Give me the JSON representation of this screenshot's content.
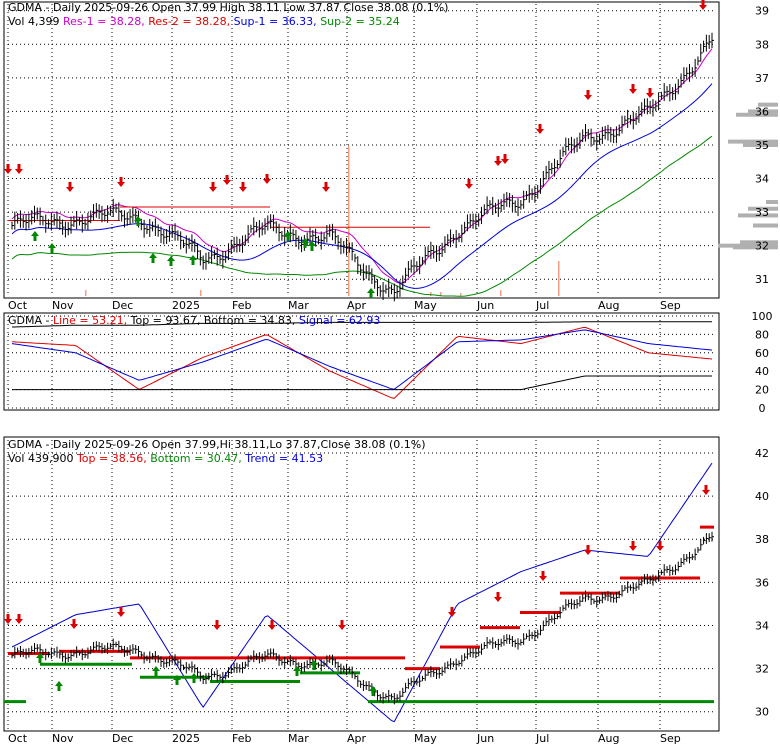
{
  "months": [
    "Oct",
    "Nov",
    "Dec",
    "2025",
    "Feb",
    "Mar",
    "Apr",
    "May",
    "Jun",
    "Jul",
    "Aug",
    "Sep"
  ],
  "colors": {
    "price": "#000000",
    "res": "#dd0000",
    "sup": "#0000dd",
    "sup2": "#008800",
    "magenta": "#cc00cc",
    "signal": "#0000dd",
    "volume_profile": "#b0b0b0",
    "bg": "#ffffff",
    "grid": "#000000",
    "ma_blue": "#0000cc"
  },
  "panels": [
    {
      "header_items": [
        {
          "text": "GDMA - Daily 2025-09-26 Open 37.99  High 38.11  Low 37.87  Close 38.08 (0.1%)",
          "color": "#000000"
        }
      ],
      "header_items2": [
        {
          "text": "Vol 4,399 ",
          "color": "#000000"
        },
        {
          "text": "Res-1 = 38.28, ",
          "color": "#cc00cc"
        },
        {
          "text": "Res-2 = 38.28, ",
          "color": "#dd0000"
        },
        {
          "text": "Sup-1 = 36.33, ",
          "color": "#0000dd"
        },
        {
          "text": "Sup-2 = 35.24",
          "color": "#008800"
        }
      ],
      "y_ticks": [
        "39",
        "38",
        "37",
        "36",
        "35",
        "34",
        "33",
        "32",
        "31"
      ]
    },
    {
      "header_items": [
        {
          "text": "GDMA - ",
          "color": "#000000"
        },
        {
          "text": "Line = 53.21, ",
          "color": "#dd0000"
        },
        {
          "text": "Top = 93.67, ",
          "color": "#000000"
        },
        {
          "text": "Bottom = 34.83, ",
          "color": "#000000"
        },
        {
          "text": "Signal = 62.93",
          "color": "#0000dd"
        }
      ],
      "y_ticks": [
        "100",
        "80",
        "60",
        "40",
        "20",
        "0"
      ]
    },
    {
      "header_items": [
        {
          "text": "GDMA - Daily 2025-09-26 Open 37.99,Hi 38.11,Lo 37.87,Close 38.08 (0.1%)",
          "color": "#000000"
        }
      ],
      "header_items2": [
        {
          "text": "Vol 439,900 ",
          "color": "#000000"
        },
        {
          "text": "Top = 38.56, ",
          "color": "#dd0000"
        },
        {
          "text": "Bottom = 30.47, ",
          "color": "#008800"
        },
        {
          "text": "Trend = 41.53",
          "color": "#0000dd"
        }
      ],
      "y_ticks": [
        "42",
        "40",
        "38",
        "36",
        "34",
        "32",
        "30"
      ]
    }
  ],
  "chart_data": [
    {
      "type": "line",
      "title": "GDMA - Daily 2025-09-26 Open 37.99  High 38.11  Low 37.87  Close 38.08 (0.1%)",
      "x": [
        "Oct",
        "Nov",
        "Dec",
        "2025",
        "Feb",
        "Mar",
        "Apr",
        "May",
        "Jun",
        "Jul",
        "Aug",
        "Sep"
      ],
      "ylim": [
        30.5,
        39.2
      ],
      "series": [
        {
          "values": [
            32.6,
            32.8,
            32.9,
            31.6,
            32.5,
            32.2,
            30.6,
            32.5,
            33.4,
            35.2,
            35.9,
            38.1
          ]
        }
      ]
    },
    {
      "type": "line",
      "title": "GDMA - Line = 53.21, Top = 93.67, Bottom = 34.83, Signal = 62.93",
      "x": [
        "Oct",
        "Nov",
        "Dec",
        "2025",
        "Feb",
        "Mar",
        "Apr",
        "May",
        "Jun",
        "Jul",
        "Aug",
        "Sep"
      ],
      "ylim": [
        0,
        100
      ],
      "series": [
        {
          "name": "Line",
          "values": [
            72,
            68,
            20,
            55,
            80,
            40,
            10,
            78,
            70,
            88,
            60,
            53.21
          ]
        },
        {
          "name": "Signal",
          "values": [
            70,
            60,
            30,
            50,
            75,
            45,
            20,
            72,
            74,
            85,
            70,
            62.93
          ]
        }
      ]
    },
    {
      "type": "line",
      "title": "GDMA - Daily 2025-09-26 Open 37.99,Hi 38.11,Lo 37.87,Close 38.08 (0.1%)",
      "x": [
        "Oct",
        "Nov",
        "Dec",
        "2025",
        "Feb",
        "Mar",
        "Apr",
        "May",
        "Jun",
        "Jul",
        "Aug",
        "Sep"
      ],
      "ylim": [
        29.2,
        42.6
      ],
      "series": [
        {
          "values": [
            32.6,
            32.8,
            32.9,
            31.6,
            32.5,
            32.2,
            30.6,
            32.5,
            33.4,
            35.2,
            35.9,
            38.1
          ]
        },
        {
          "name": "Trend",
          "values": [
            33,
            34.5,
            35,
            30.2,
            34.5,
            32,
            29.5,
            35,
            36.5,
            37.5,
            37.2,
            41.53
          ]
        },
        {
          "name": "Top",
          "values": [
            32.7,
            32.9,
            32.5,
            32.5,
            32.5,
            32.5,
            32.0,
            32.0,
            33.0,
            35.5,
            36.2,
            38.56
          ]
        },
        {
          "name": "Bottom",
          "values": [
            30.47,
            32.2,
            32.2,
            31.5,
            31.5,
            31.8,
            30.47,
            30.47,
            30.47,
            30.47,
            30.47,
            30.47
          ]
        }
      ]
    }
  ]
}
